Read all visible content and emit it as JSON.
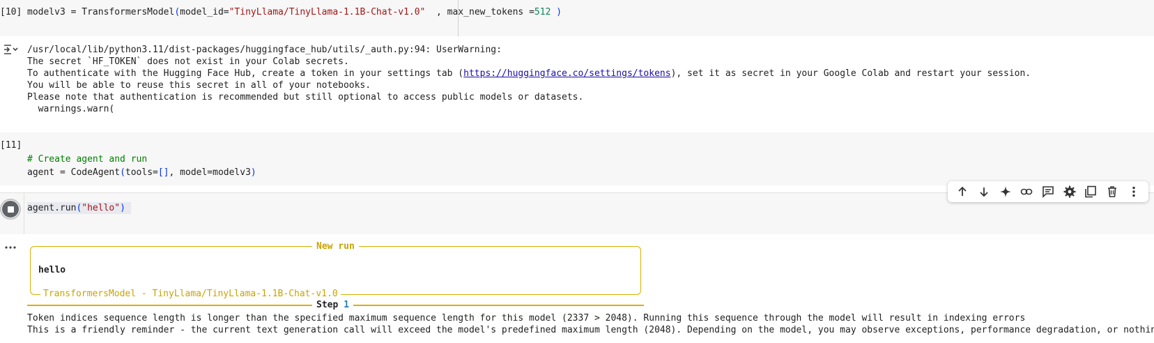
{
  "cells": {
    "cell10": {
      "count": "[10]",
      "code": {
        "prefix": "modelv3 = TransformersModel",
        "open": "(",
        "arg1": "model_id=",
        "str": "\"TinyLlama/TinyLlama-1.1B-Chat-v1.0\"",
        "mid": "  , max_new_tokens =",
        "num": "512",
        "close": " )"
      }
    },
    "output10": {
      "lines": [
        "/usr/local/lib/python3.11/dist-packages/huggingface_hub/utils/_auth.py:94: UserWarning:",
        "The secret `HF_TOKEN` does not exist in your Colab secrets.",
        "You will be able to reuse this secret in all of your notebooks.",
        "Please note that authentication is recommended but still optional to access public models or datasets.",
        "  warnings.warn("
      ],
      "auth_pre": "To authenticate with the Hugging Face Hub, create a token in your settings tab (",
      "auth_link": "https://huggingface.co/settings/tokens",
      "auth_post": "), set it as secret in your Google Colab and restart your session."
    },
    "cell11": {
      "count": "[11]",
      "comment": "# Create agent and run",
      "code_a": "agent = CodeAgent",
      "code_b": "tools=",
      "code_c": "[]",
      "code_d": ", model=modelv3"
    },
    "cell12": {
      "code_a": "agent.run",
      "code_str": "\"hello\""
    },
    "output12": {
      "new_run": "New run",
      "task": "hello",
      "model_label": "TransformersModel - TinyLlama/TinyLlama-1.1B-Chat-v1.0",
      "step_word": "Step ",
      "step_num": "1",
      "lines": [
        "Token indices sequence length is longer than the specified maximum sequence length for this model (2337 > 2048). Running this sequence through the model will result in indexing errors",
        "This is a friendly reminder - the current text generation call will exceed the model's predefined maximum length (2048). Depending on the model, you may observe exceptions, performance degradation, or nothing a"
      ]
    }
  },
  "toolbar": [
    "arrow-up-icon",
    "arrow-down-icon",
    "sparkle-icon",
    "link-icon",
    "comment-icon",
    "gear-icon",
    "mirror-cell-icon",
    "trash-icon",
    "more-vert-icon"
  ],
  "colors": {
    "string": "#a31515",
    "number": "#098658",
    "comment": "#008000",
    "rich_border": "#d8b000"
  }
}
